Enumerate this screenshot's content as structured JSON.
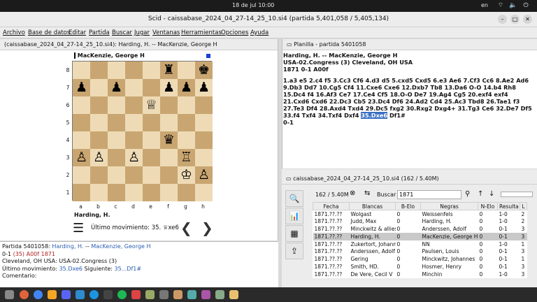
{
  "system": {
    "clock": "18 de jul  10:00",
    "lang": "en"
  },
  "window": {
    "title": "Scid - caissabase_2024_04_27-14_25_10.si4 (partida 5,401,058 / 5,405,134)"
  },
  "menu": [
    "Archivo",
    "Base de datos",
    "Editar",
    "Partida",
    "Buscar",
    "Jugar",
    "Ventanas",
    "Herramientas",
    "Opciones",
    "Ayuda"
  ],
  "board_pane": {
    "tab": "(caissabase_2024_04_27-14_25_10.si4): Harding, H. -- MacKenzie, George H",
    "top_player": "MacKenzie, George H",
    "bottom_player": "Harding, H.",
    "last_move": "Último movimiento: 35. ♕xe6",
    "ranks": [
      "8",
      "7",
      "6",
      "5",
      "4",
      "3",
      "2",
      "1"
    ],
    "files": [
      "a",
      "b",
      "c",
      "d",
      "e",
      "f",
      "g",
      "h"
    ]
  },
  "info": {
    "game_label": "Partida 5401058:",
    "white": "Harding, H.",
    "sep": "--",
    "black": "MacKenzie, George H",
    "result": "0-1",
    "elo": "(35)",
    "eco": "A00f",
    "year": "1871",
    "site": "Cleveland, OH USA:  USA-02.Congress (3)",
    "last_label": "Último movimiento:",
    "last_move": "35.Dxe6",
    "next_label": "Siguiente:",
    "next_move": "35...Df1#",
    "comment": "Comentario:"
  },
  "notation_pane": {
    "tab": "Planilla - partida 5401058",
    "header_line1": "Harding, H.   --   MacKenzie, George H",
    "header_line2": "USA-02.Congress (3)  Cleveland, OH USA",
    "header_line3": "1871  0-1  A00f",
    "moves_before": "1.a3 e5 2.c4 f5 3.Cc3 Cf6 4.d3 d5 5.cxd5 Cxd5 6.e3 Ae6 7.Cf3 Cc6 8.Ae2 Ad6 9.Db3 Dd7 10.Cg5 Cf4 11.Cxe6 Cxe6 12.Dxb7 Tb8 13.Da6 O-O 14.b4 Rh8 15.Dc4 f4 16.Af3 Ce7 17.Ce4 Cf5 18.O-O De7 19.Ag4 Cg5 20.exf4 exf4 21.Cxd6 Cxd6 22.Dc3 Cb5 23.Dc4 Df6 24.Ad2 Cd4 25.Ac3 Tbd8 26.Tae1 f3 27.Te3 Df4 28.Axd4 Txd4 29.Dc5 fxg2 30.Rxg2 Dxg4+ 31.Tg3 Ce6 32.De7 Df5 33.f4 Txf4 34.Txf4 Dxf4",
    "highlight": "35.Dxe6",
    "moves_after": "Df1#",
    "result": "0-1"
  },
  "db_pane": {
    "tab": "caissabase_2024_04_27-14_25_10.si4 (162 / 5.40M)",
    "count": "162 / 5.40M",
    "search_label": "Buscar",
    "search_value": "1871",
    "columns": [
      "Fecha",
      "Blancas",
      "B-Elo",
      "Negras",
      "N-Elo",
      "Resulta",
      "L"
    ],
    "rows": [
      [
        "1871.??.??",
        "Wolgast",
        "0",
        "Weissenfels",
        "0",
        "1-0",
        "2"
      ],
      [
        "1871.??.??",
        "Judd, Max",
        "0",
        "Harding, H.",
        "0",
        "1-0",
        "2"
      ],
      [
        "1871.??.??",
        "Minckwitz & allies",
        "0",
        "Anderssen, Adolf",
        "0",
        "0-1",
        "3"
      ],
      [
        "1871.??.??",
        "Harding, H.",
        "0",
        "MacKenzie, George H",
        "0",
        "0-1",
        "3"
      ],
      [
        "1871.??.??",
        "Zukertort, Johanne",
        "0",
        "NN",
        "0",
        "1-0",
        "1"
      ],
      [
        "1871.??.??",
        "Anderssen, Adolf",
        "0",
        "Paulsen, Louis",
        "0",
        "0-1",
        "3"
      ],
      [
        "1871.??.??",
        "Gering",
        "0",
        "Minckwitz, Johannes",
        "0",
        "0-1",
        "1"
      ],
      [
        "1871.??.??",
        "Smith, HD.",
        "0",
        "Hosmer, Henry",
        "0",
        "0-1",
        "3"
      ],
      [
        "1871.??.??",
        "De Vere, Cecil V",
        "0",
        "Minchin",
        "0",
        "1-0",
        "3"
      ]
    ],
    "selected_row": 3
  },
  "colors": {
    "light_square": "#eedbb6",
    "dark_square": "#c9a671",
    "highlight": "#3a6fc3",
    "link": "#2b5fb0"
  }
}
